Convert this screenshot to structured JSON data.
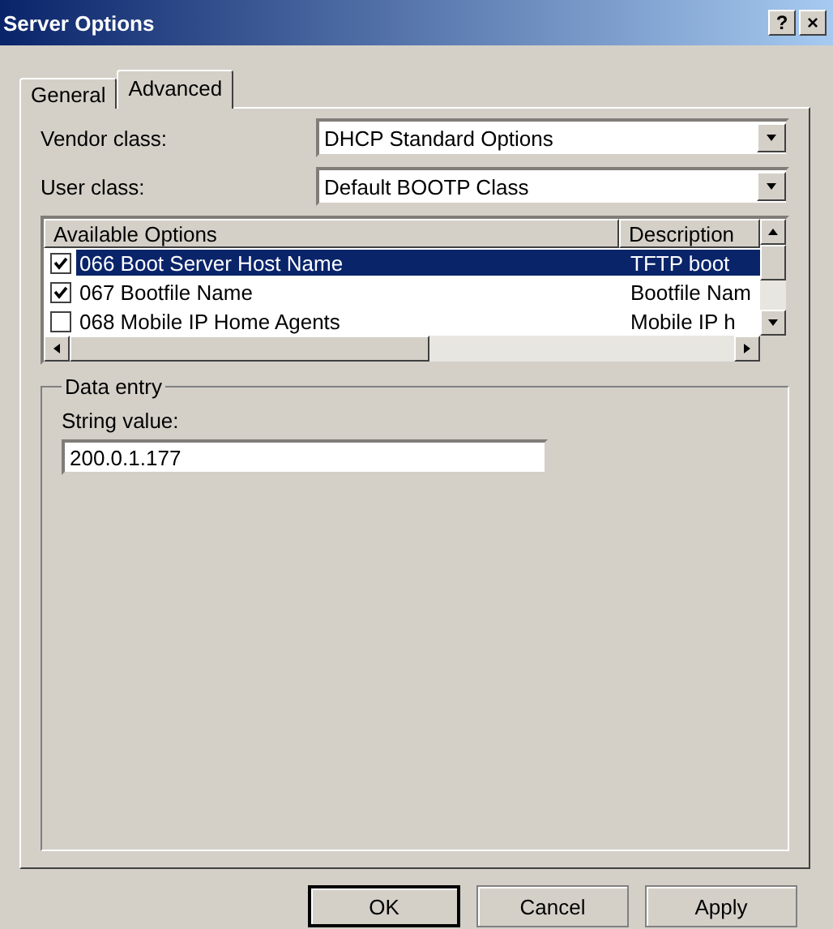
{
  "window": {
    "title": "Server Options",
    "help_button": "?",
    "close_button": "×"
  },
  "tabs": [
    {
      "label": "General",
      "selected": false
    },
    {
      "label": "Advanced",
      "selected": true
    }
  ],
  "vendor_class": {
    "label": "Vendor class:",
    "value": "DHCP Standard Options"
  },
  "user_class": {
    "label": "User class:",
    "value": "Default BOOTP Class"
  },
  "options_list": {
    "columns": [
      "Available Options",
      "Description"
    ],
    "rows": [
      {
        "name": "066 Boot Server Host Name",
        "description": "TFTP boot",
        "checked": true,
        "selected": true
      },
      {
        "name": "067 Bootfile Name",
        "description": "Bootfile Nam",
        "checked": true,
        "selected": false
      },
      {
        "name": "068 Mobile IP Home Agents",
        "description": "Mobile IP h",
        "checked": false,
        "selected": false
      }
    ]
  },
  "data_entry": {
    "legend": "Data entry",
    "label": "String value:",
    "value": "200.0.1.177"
  },
  "buttons": [
    "OK",
    "Cancel",
    "Apply"
  ]
}
